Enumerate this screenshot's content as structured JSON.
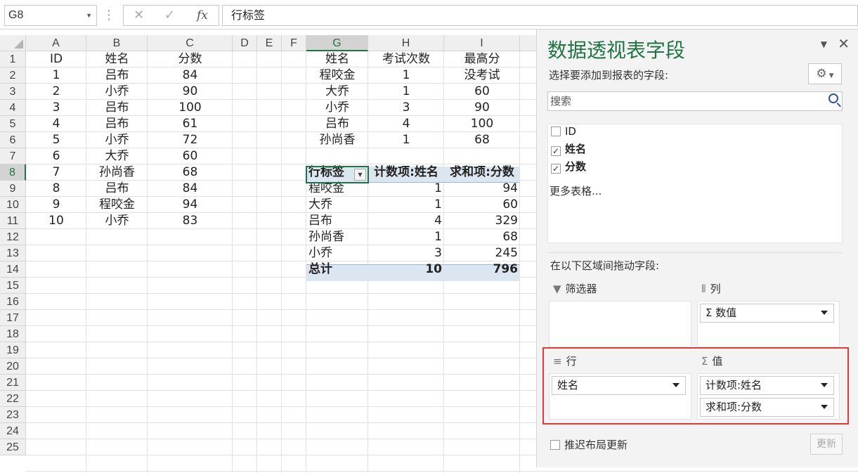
{
  "formula_bar": {
    "name_box": "G8",
    "cancel_icon": "✕",
    "enter_icon": "✓",
    "fx_label": "fx",
    "formula": "行标签"
  },
  "columns": [
    "A",
    "B",
    "C",
    "D",
    "E",
    "F",
    "G",
    "H",
    "I"
  ],
  "rows": [
    "1",
    "2",
    "3",
    "4",
    "5",
    "6",
    "7",
    "8",
    "9",
    "10",
    "11",
    "12",
    "13",
    "14",
    "15",
    "16",
    "17",
    "18",
    "19",
    "20",
    "21",
    "22",
    "23",
    "24",
    "25"
  ],
  "source_table": {
    "headers": [
      "ID",
      "姓名",
      "分数"
    ],
    "rows": [
      [
        "1",
        "吕布",
        "84"
      ],
      [
        "2",
        "小乔",
        "90"
      ],
      [
        "3",
        "吕布",
        "100"
      ],
      [
        "4",
        "吕布",
        "61"
      ],
      [
        "5",
        "小乔",
        "72"
      ],
      [
        "6",
        "大乔",
        "60"
      ],
      [
        "7",
        "孙尚香",
        "68"
      ],
      [
        "8",
        "吕布",
        "84"
      ],
      [
        "9",
        "程咬金",
        "94"
      ],
      [
        "10",
        "小乔",
        "83"
      ]
    ]
  },
  "summary_table": {
    "headers": [
      "姓名",
      "考试次数",
      "最高分"
    ],
    "rows": [
      [
        "程咬金",
        "1",
        "没考试"
      ],
      [
        "大乔",
        "1",
        "60"
      ],
      [
        "小乔",
        "3",
        "90"
      ],
      [
        "吕布",
        "4",
        "100"
      ],
      [
        "孙尚香",
        "1",
        "68"
      ]
    ]
  },
  "pivot": {
    "headers": [
      "行标签",
      "计数项:姓名",
      "求和项:分数"
    ],
    "rows": [
      [
        "程咬金",
        "1",
        "94"
      ],
      [
        "大乔",
        "1",
        "60"
      ],
      [
        "吕布",
        "4",
        "329"
      ],
      [
        "孙尚香",
        "1",
        "68"
      ],
      [
        "小乔",
        "3",
        "245"
      ]
    ],
    "total": [
      "总计",
      "10",
      "796"
    ]
  },
  "panel": {
    "title": "数据透视表字段",
    "subtitle": "选择要添加到报表的字段:",
    "search_placeholder": "搜索",
    "fields": [
      {
        "label": "ID",
        "checked": false
      },
      {
        "label": "姓名",
        "checked": true
      },
      {
        "label": "分数",
        "checked": true
      }
    ],
    "more_tables": "更多表格...",
    "drag_label": "在以下区域间拖动字段:",
    "areas": {
      "filters": {
        "title": "筛选器",
        "icon": "filter-icon"
      },
      "columns": {
        "title": "列",
        "icon": "columns-icon",
        "items": [
          "Σ 数值"
        ]
      },
      "rows": {
        "title": "行",
        "icon": "rows-icon",
        "items": [
          "姓名"
        ]
      },
      "values": {
        "title": "值",
        "icon": "sigma-icon",
        "items": [
          "计数项:姓名",
          "求和项:分数"
        ]
      }
    },
    "defer_label": "推迟布局更新",
    "update_button": "更新"
  },
  "colors": {
    "accent": "#217346",
    "pivot_fill": "#dce6f1",
    "highlight": "#e53935"
  }
}
